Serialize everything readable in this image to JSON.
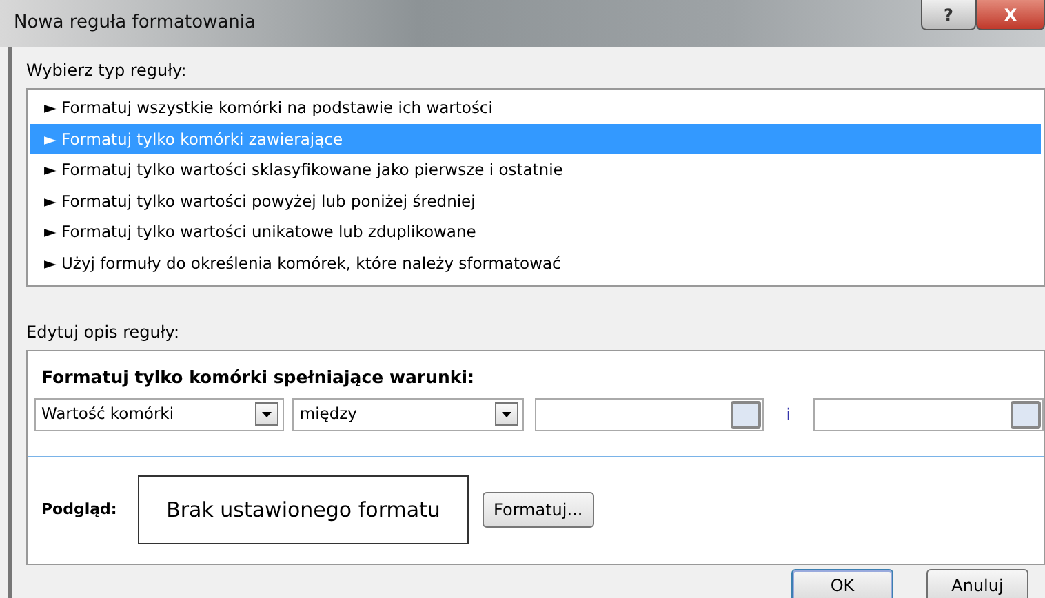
{
  "window": {
    "title": "Nowa reguła formatowania",
    "title_buttons": [
      "?",
      "X"
    ]
  },
  "rule_type": {
    "label": "Wybierz typ reguły:",
    "items": [
      {
        "label": "► Formatuj wszystkie komórki na podstawie ich wartości",
        "selected": false
      },
      {
        "label": "► Formatuj tylko komórki zawierające",
        "selected": true
      },
      {
        "label": "► Formatuj tylko wartości sklasyfikowane jako pierwsze i ostatnie",
        "selected": false
      },
      {
        "label": "► Formatuj tylko wartości powyżej lub poniżej średniej",
        "selected": false
      },
      {
        "label": "► Formatuj tylko wartości unikatowe lub zduplikowane",
        "selected": false
      },
      {
        "label": "► Użyj formuły do określenia komórek, które należy sformatować",
        "selected": false
      }
    ]
  },
  "rule_description": {
    "label": "Edytuj opis reguły:",
    "heading": "Formatuj tylko komórki spełniające warunki:",
    "condition_dropdown": "Wartość komórki",
    "operator_dropdown": "między",
    "connector": "i",
    "preview_label": "Podgląd:",
    "preview_text": "Brak ustawionego formatu",
    "format_button": "Formatuj..."
  },
  "buttons": [
    "OK",
    "Anuluj"
  ]
}
